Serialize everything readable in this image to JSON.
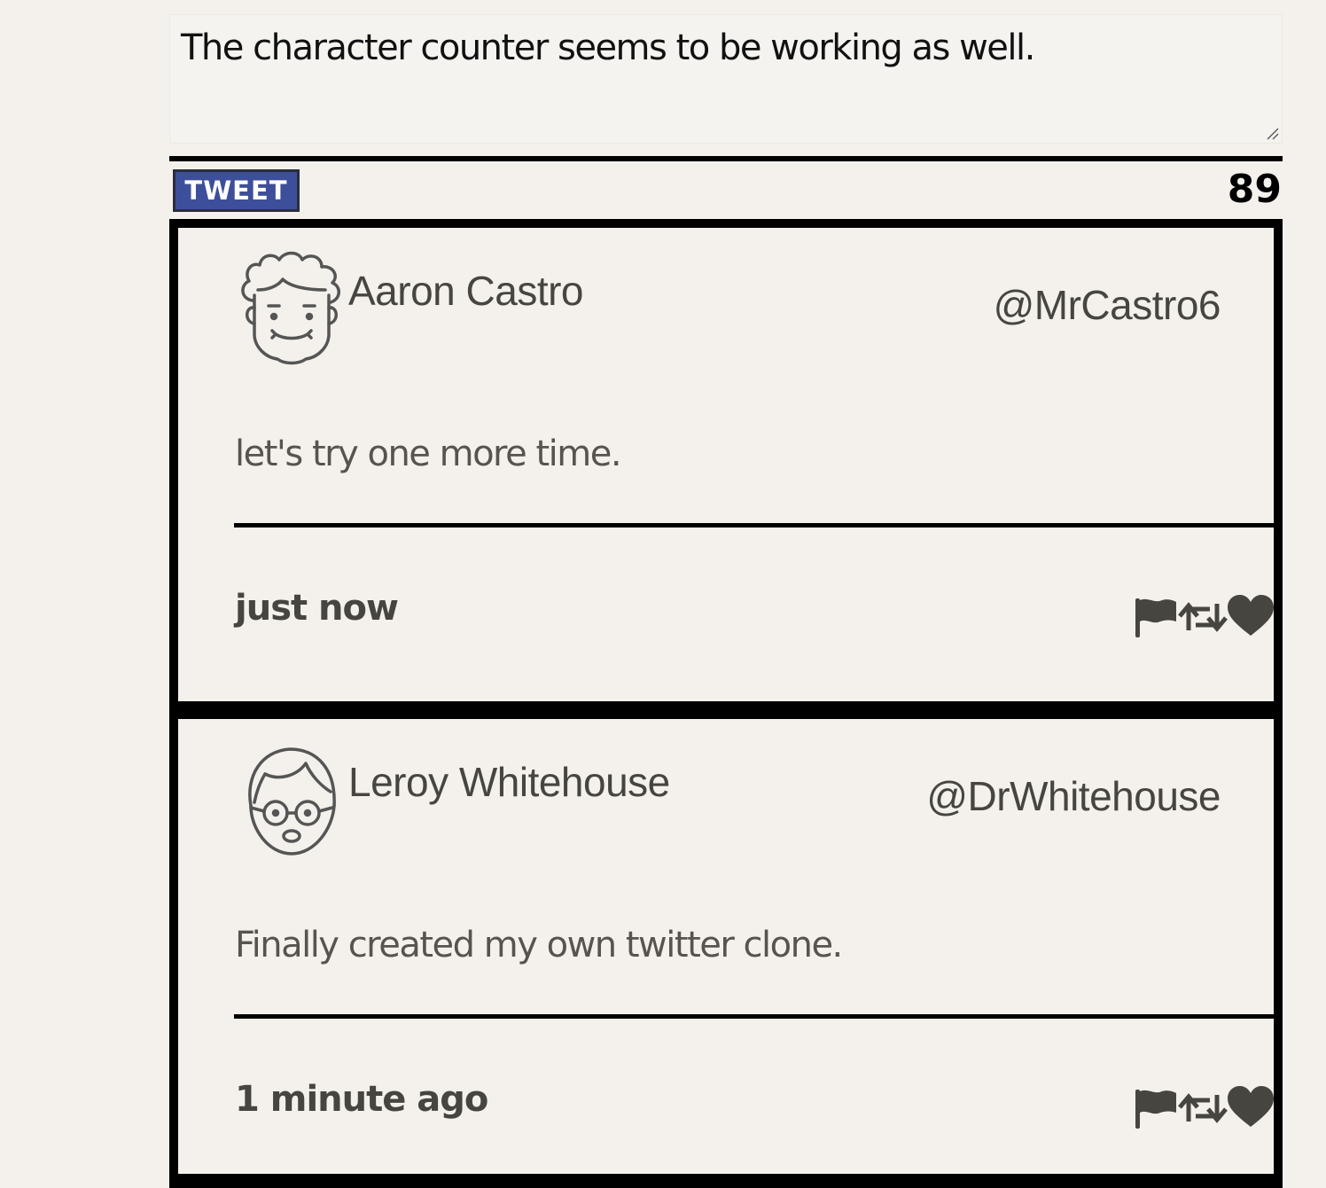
{
  "composer": {
    "text": "The character counter seems to be working as well."
  },
  "toolbar": {
    "tweet_label": "TWEET",
    "char_count": "89"
  },
  "tweets": [
    {
      "name": "Aaron Castro",
      "handle": "@MrCastro6",
      "content": "let's try one more time.",
      "time": "just now",
      "avatar": "curly-hair-avatar"
    },
    {
      "name": "Leroy Whitehouse",
      "handle": "@DrWhitehouse",
      "content": "Finally created my own twitter clone.",
      "time": "1 minute ago",
      "avatar": "glasses-avatar"
    }
  ],
  "icons": {
    "flag": "flag-icon",
    "retweet": "retweet-icon",
    "like": "heart-icon"
  },
  "colors": {
    "background": "#f4f1ec",
    "button": "#3d4f9a",
    "text": "#474540",
    "border": "#000000"
  }
}
